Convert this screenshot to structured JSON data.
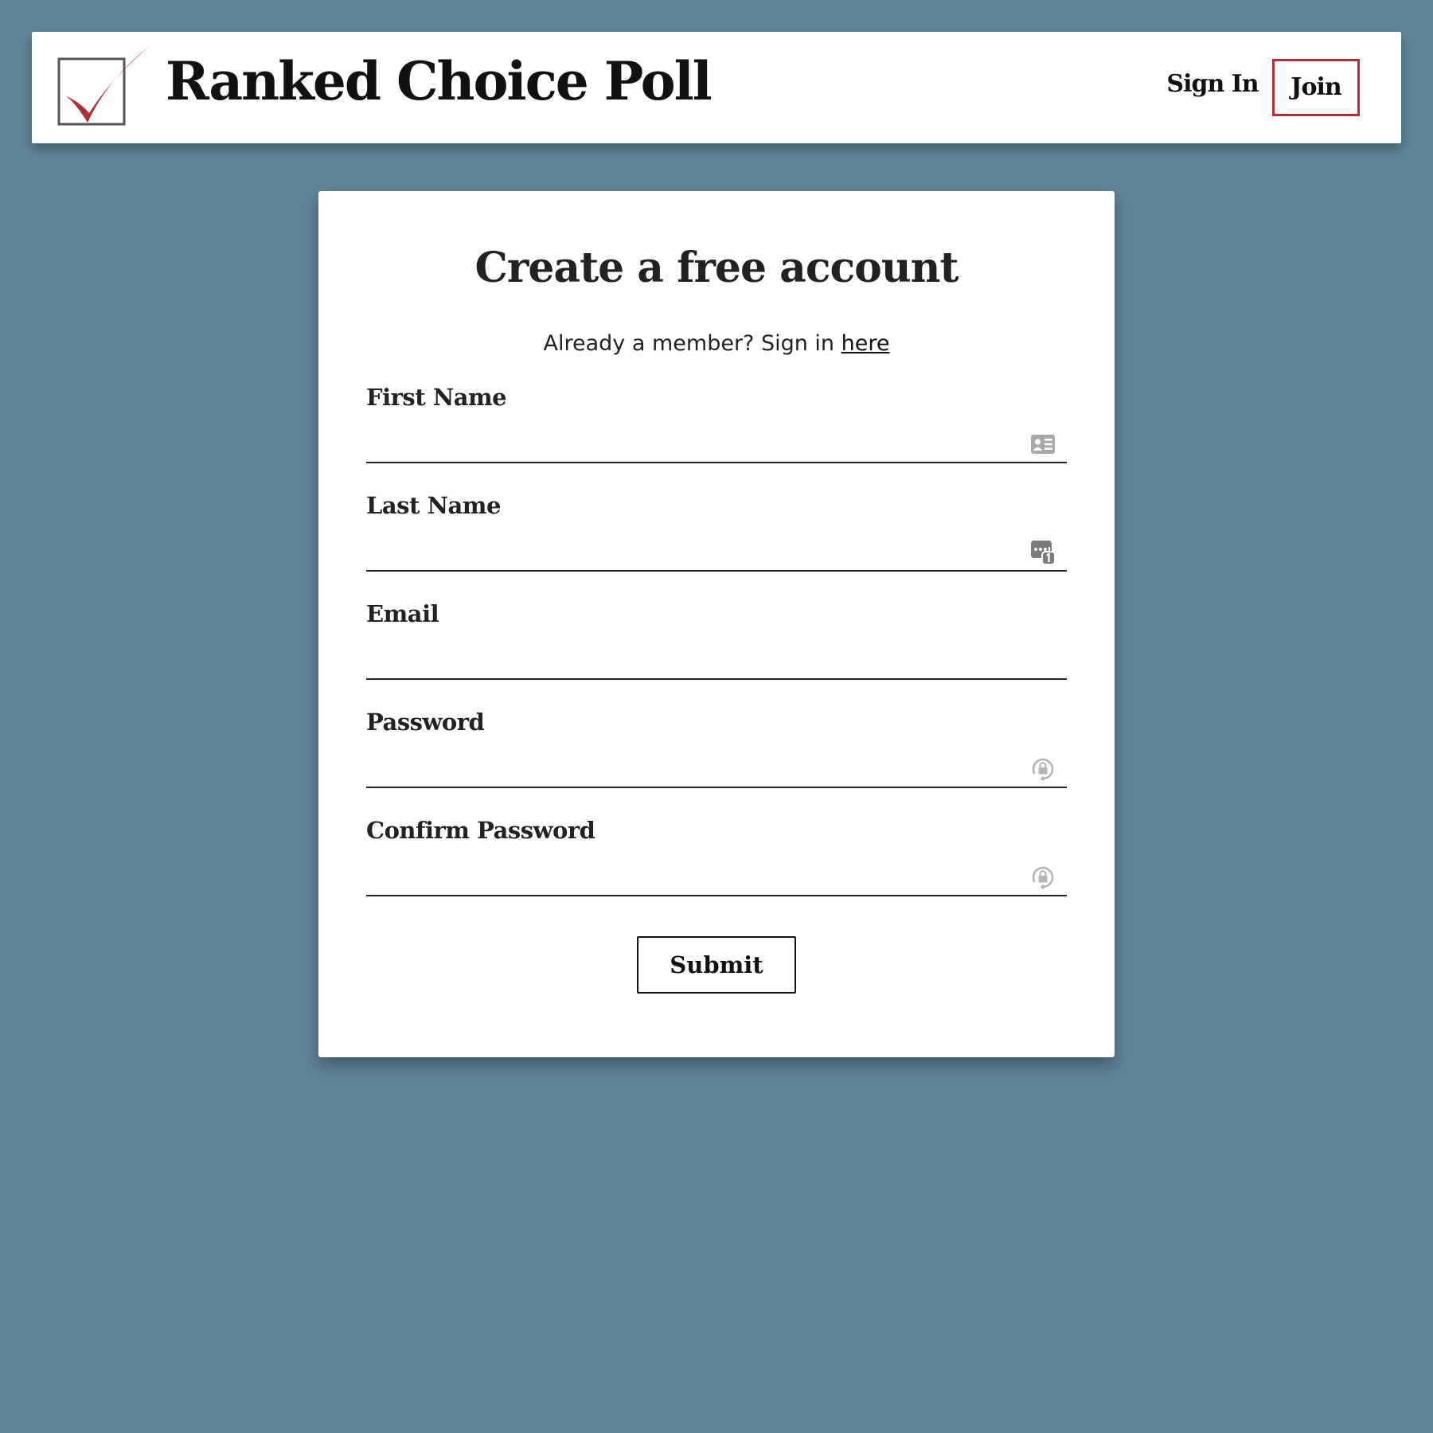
{
  "header": {
    "logo": {
      "icon": "checkbox-checkmark-icon",
      "box_color": "#555555",
      "check_color": "#b03035"
    },
    "title": "Ranked Choice Poll",
    "nav": {
      "sign_in_label": "Sign In",
      "join_label": "Join",
      "join_border_color": "#b03035"
    }
  },
  "form": {
    "title": "Create a free account",
    "member_prompt": "Already a member? Sign in ",
    "member_link": "here",
    "fields": [
      {
        "label": "First Name",
        "value": "",
        "icon": "contact-card-icon"
      },
      {
        "label": "Last Name",
        "value": "",
        "icon": "password-manager-icon"
      },
      {
        "label": "Email",
        "value": "",
        "icon": ""
      },
      {
        "label": "Password",
        "value": "",
        "icon": "password-lock-icon"
      },
      {
        "label": "Confirm Password",
        "value": "",
        "icon": "password-lock-icon"
      }
    ],
    "submit_label": "Submit"
  },
  "colors": {
    "background": "#5e8597",
    "accent": "#b03035",
    "text": "#222222"
  }
}
